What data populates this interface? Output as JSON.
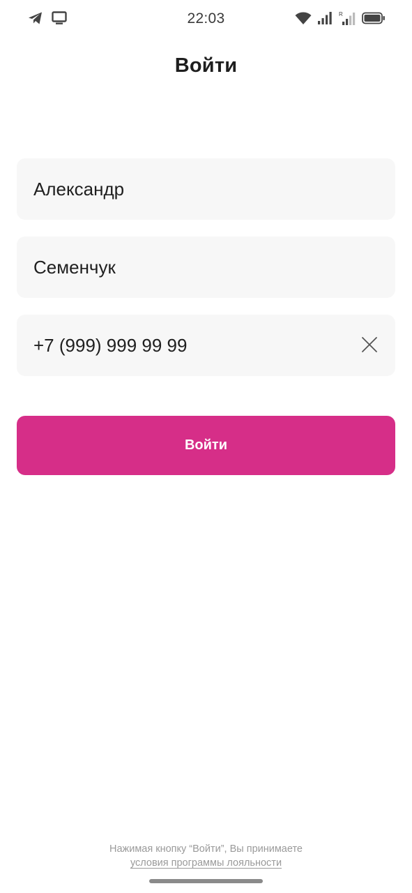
{
  "status_bar": {
    "time": "22:03",
    "left_icons": [
      "telegram-icon",
      "monitor-icon"
    ],
    "right_icons": [
      "wifi-icon",
      "signal-icon",
      "roaming-signal-icon",
      "battery-icon"
    ],
    "roaming_label": "R"
  },
  "page": {
    "title": "Войти"
  },
  "form": {
    "first_name": "Александр",
    "last_name": "Семенчук",
    "phone": "+7 (999) 999 99 99",
    "submit_label": "Войти"
  },
  "footer": {
    "notice": "Нажимая кнопку “Войти”, Вы принимаете",
    "link_label": "условия программы лояльности"
  },
  "colors": {
    "accent": "#d62e88",
    "field_bg": "#f7f7f7",
    "footer_text": "#9a9a9a"
  }
}
